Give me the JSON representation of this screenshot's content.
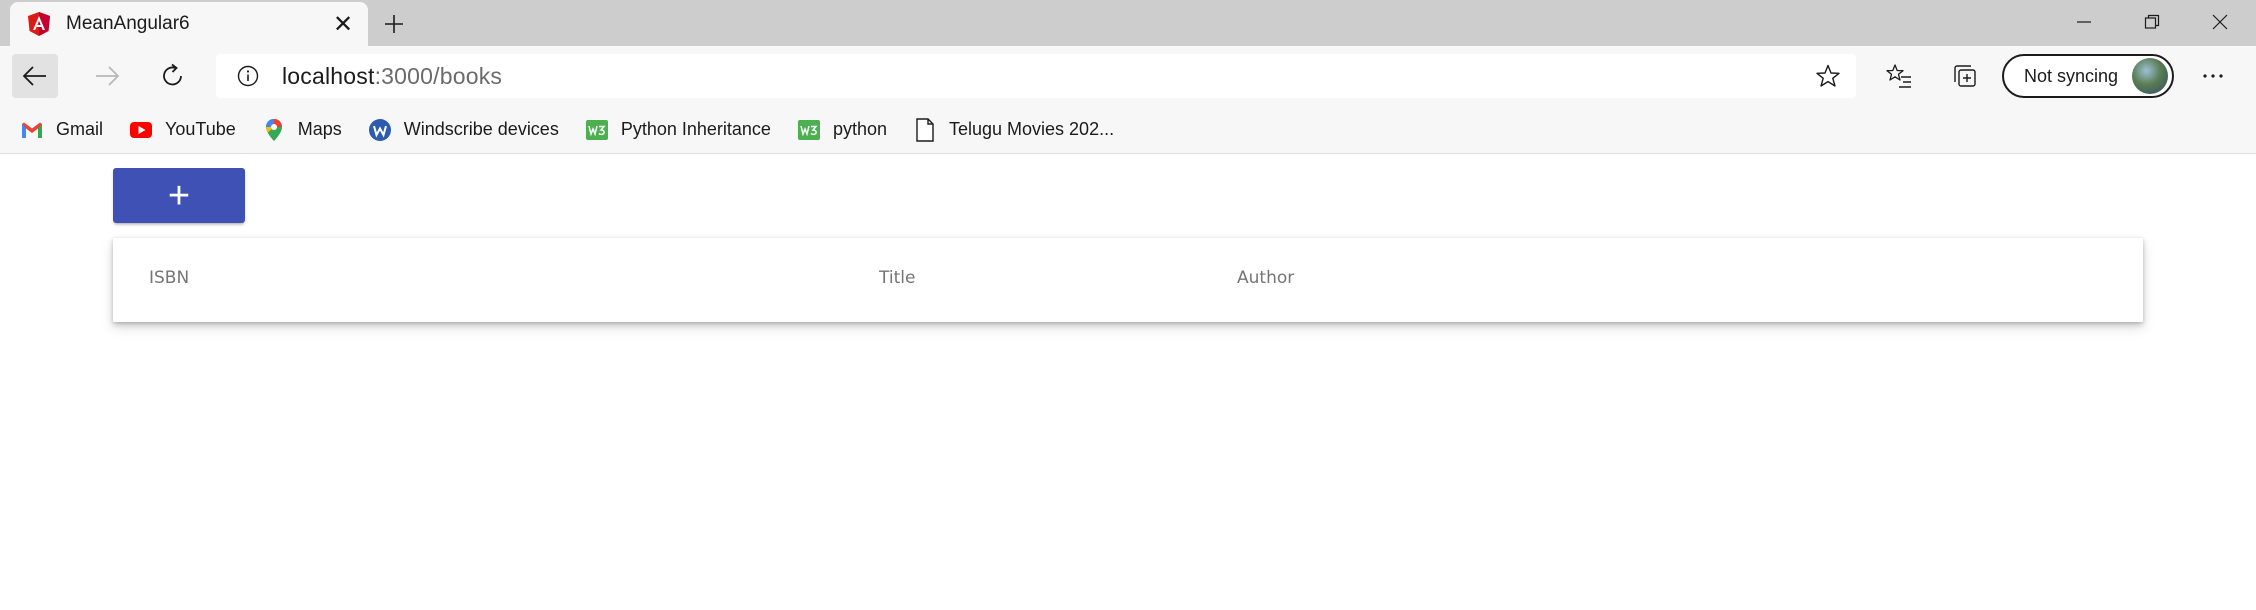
{
  "tab": {
    "title": "MeanAngular6",
    "favicon": "angular-icon",
    "close_glyph": "✕"
  },
  "window_controls": [
    "minimize-icon",
    "restore-icon",
    "close-icon"
  ],
  "address_bar": {
    "host": "localhost",
    "path": ":3000/books"
  },
  "profile": {
    "sync_label": "Not syncing"
  },
  "bookmarks": [
    {
      "label": "Gmail",
      "icon": "gmail-icon"
    },
    {
      "label": "YouTube",
      "icon": "youtube-icon"
    },
    {
      "label": "Maps",
      "icon": "maps-icon"
    },
    {
      "label": "Windscribe devices",
      "icon": "windscribe-icon"
    },
    {
      "label": "Python Inheritance",
      "icon": "w3schools-icon"
    },
    {
      "label": "python",
      "icon": "w3schools-icon"
    },
    {
      "label": "Telugu Movies 202...",
      "icon": "page-icon"
    }
  ],
  "page": {
    "add_button_label": "+",
    "table_headers": [
      "ISBN",
      "Title",
      "Author"
    ]
  },
  "colors": {
    "primary": "#3f51b5",
    "tabstrip": "#cdcdcd",
    "toolbar": "#f7f7f7"
  }
}
